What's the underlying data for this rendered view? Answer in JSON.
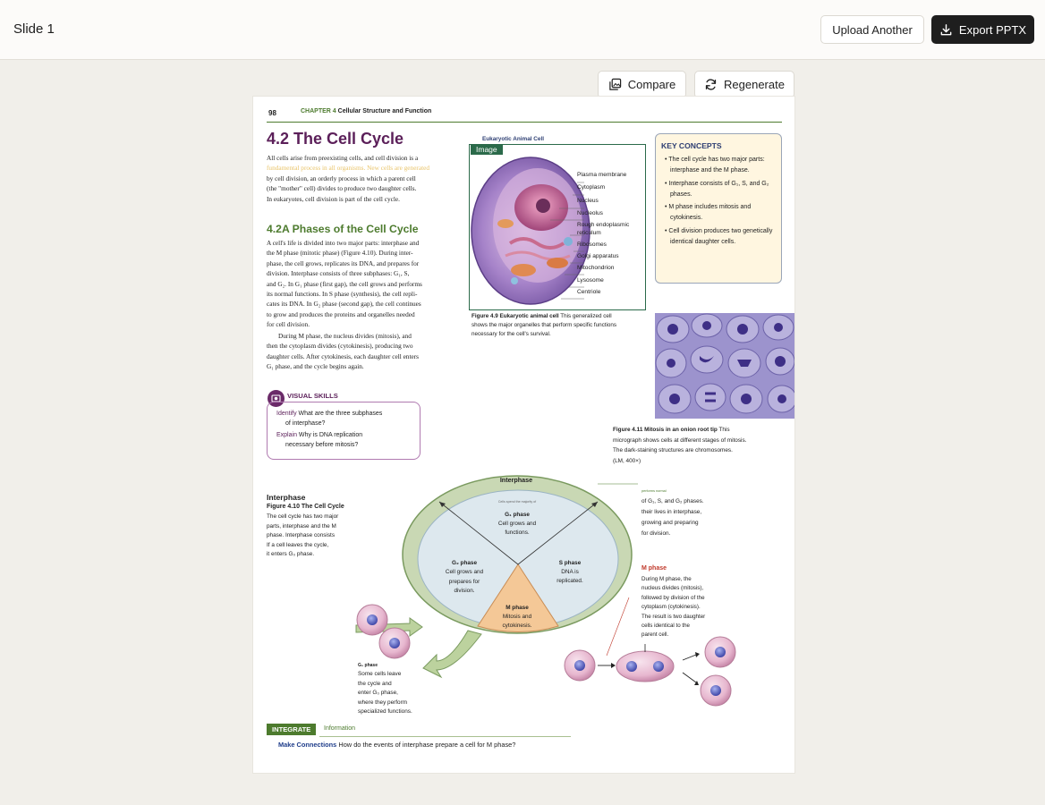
{
  "app": {
    "slide_title": "Slide 1",
    "upload_label": "Upload Another",
    "export_label": "Export PPTX",
    "compare_label": "Compare",
    "regenerate_label": "Regenerate"
  },
  "page": {
    "page_number": "98",
    "chapter_label": "CHAPTER 4",
    "chapter_title": "Cellular Structure and Function",
    "section_title": "4.2 The Cell Cycle",
    "intro_l1": "All cells arise from preexisting cells, and cell division is a",
    "intro_l2": "fundamental process in all organisms. New cells are generated",
    "intro_l3": "by cell division, an orderly process in which a parent cell",
    "intro_l4": "(the \"mother\" cell) divides to produce two daughter cells.",
    "intro_l5": "In eukaryotes, cell division is part of the cell cycle.",
    "subsection_title": "4.2A Phases of the Cell Cycle",
    "p1": [
      "A cell's life is divided into two major parts: interphase and",
      "the M phase (mitotic phase) (Figure 4.10). During inter-",
      "phase, the cell grows, replicates its DNA, and prepares for",
      "division. Interphase consists of three subphases: G₁, S,",
      "and G₂. In G₁ phase (first gap), the cell grows and performs",
      "its normal functions. In S phase (synthesis), the cell repli-",
      "cates its DNA. In G₂ phase (second gap), the cell continues",
      "to grow and produces the proteins and organelles needed",
      "for cell division."
    ],
    "p2": [
      "During M phase, the nucleus divides (mitosis), and",
      "then the cytoplasm divides (cytokinesis), producing two",
      "daughter cells. After cytokinesis, each daughter cell enters",
      "G₁ phase, and the cycle begins again."
    ],
    "figure_heading": "Eukaryotic Animal Cell",
    "image_tag": "Image",
    "organelles": [
      "Plasma membrane",
      "Cytoplasm",
      "Nucleus",
      "Nucleolus",
      "Rough endoplasmic reticulum",
      "Ribosomes",
      "Golgi apparatus",
      "Mitochondrion",
      "Lysosome",
      "Centriole"
    ],
    "fig49_bold": "Figure 4.9 Eukaryotic animal cell",
    "fig49_l1": "This generalized cell",
    "fig49_l2": "shows the major organelles that perform specific functions",
    "fig49_l3": "necessary for the cell's survival.",
    "key_title": "KEY CONCEPTS",
    "key_items": [
      "• The cell cycle has two major parts: interphase and the M phase.",
      "• Interphase consists of G₁, S, and G₂ phases.",
      "• M phase includes mitosis and cytokinesis.",
      "• Cell division produces two genetically identical daughter cells."
    ],
    "fig411_bold": "Figure 4.11 Mitosis in an onion root tip",
    "fig411_l1": "This",
    "fig411_l2": "micrograph shows cells at different stages of mitosis.",
    "fig411_l3": "The dark-staining structures are chromosomes.",
    "fig411_l4": "(LM, 400×)",
    "visual_skills": "VISUAL SKILLS",
    "identify_label": "Identify",
    "identify_l1": "What are the three subphases",
    "identify_l2": "of interphase?",
    "explain_label": "Explain",
    "explain_l1": "Why is  DNA replication",
    "explain_l2": "necessary before mitosis?",
    "interphase_heading": "Interphase",
    "fig410_title": "Figure 4.10 The Cell Cycle",
    "fig410_lines": [
      "The cell cycle has two major",
      "parts, interphase and the M",
      "phase. Interphase consists",
      "If a cell leaves the cycle,",
      "it enters G₀ phase."
    ],
    "ring_label": "Interphase",
    "tiny_label": "Cells spend the majority of",
    "g1_title": "G₁ phase",
    "g1_lines": [
      "Cell grows and",
      "functions."
    ],
    "g2_title": "G₂ phase",
    "g2_lines": [
      "Cell grows and",
      "prepares for",
      "division."
    ],
    "s_title": "S phase",
    "s_lines": [
      "DNA is",
      "replicated."
    ],
    "m_title": "M phase",
    "m_lines": [
      "Mitosis and",
      "cytokinesis."
    ],
    "right_tiny": "performs normal",
    "right_lines": [
      "of G₁, S, and G₂ phases.",
      "their lives in interphase,",
      "growing and preparing",
      "for division."
    ],
    "mphase_heading": "M phase",
    "mphase_lines": [
      "During M phase, the",
      "nucleus divides (mitosis),",
      "followed by division of the",
      "cytoplasm (cytokinesis).",
      "The result is two daughter",
      "cells identical to the",
      "parent cell."
    ],
    "g0_title": "G₀ phase",
    "g0_lines": [
      "Some cells leave",
      "the cycle and",
      "enter G₀ phase,",
      "where they perform",
      "specialized functions."
    ],
    "integrate": "INTEGRATE",
    "information": "Information",
    "make_connections": "Make Connections",
    "question": "How do the events of interphase prepare a cell for M phase?"
  },
  "colors": {
    "accent_purple": "#5b1f59",
    "accent_green": "#4d7b2e",
    "export_button": "#1e1e1e"
  }
}
